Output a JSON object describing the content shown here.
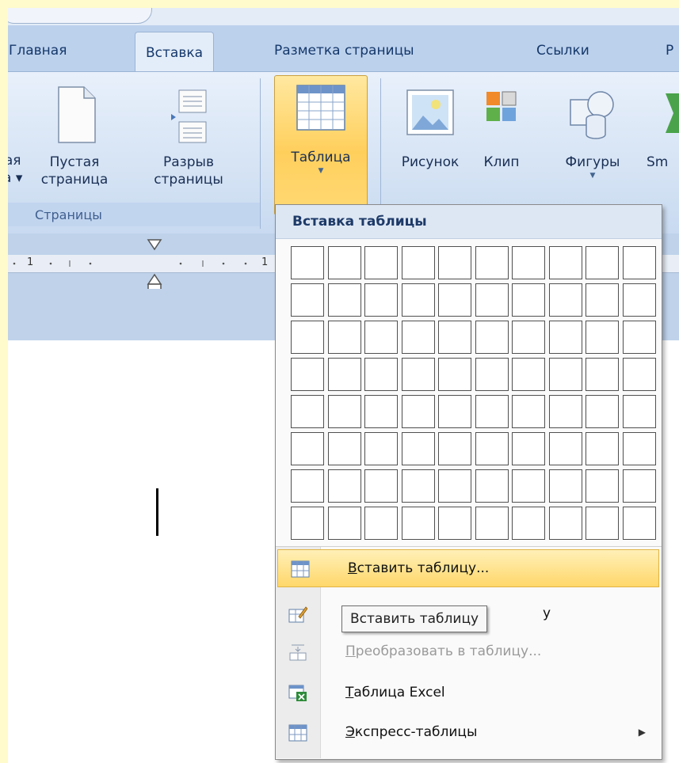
{
  "tabs": [
    {
      "label": "Главная",
      "active": false
    },
    {
      "label": "Вставка",
      "active": true
    },
    {
      "label": "Разметка страницы",
      "active": false
    },
    {
      "label": "Ссылки",
      "active": false
    },
    {
      "label": "Р",
      "active": false
    }
  ],
  "ribbon": {
    "cover_page": {
      "line1": "ая",
      "line2": "а ▾"
    },
    "blank_page": {
      "line1": "Пустая",
      "line2": "страница"
    },
    "page_break": {
      "line1": "Разрыв",
      "line2": "страницы"
    },
    "group_pages": "Страницы",
    "table": {
      "label": "Таблица"
    },
    "picture": {
      "label": "Рисунок"
    },
    "clip": {
      "label": "Клип"
    },
    "shapes": {
      "label": "Фигуры"
    },
    "smartart": {
      "label": "Sm"
    }
  },
  "ruler": {
    "num1": "1",
    "num2": "1"
  },
  "menu": {
    "title": "Вставка таблицы",
    "grid": {
      "columns": 10,
      "rows": 8
    },
    "items": [
      {
        "key": "В",
        "rest": "ставить таблицу...",
        "icon": "table-grid-icon",
        "highlighted": true
      },
      {
        "key": "",
        "rest": "у",
        "icon": "draw-table-icon"
      },
      {
        "key": "П",
        "rest": "реобразовать в таблицу...",
        "icon": "convert-table-icon",
        "disabled": true
      },
      {
        "key": "Т",
        "rest": "аблица Excel",
        "icon": "excel-table-icon"
      },
      {
        "key": "Э",
        "rest": "кспресс-таблицы",
        "icon": "quick-tables-icon"
      }
    ]
  },
  "tooltip": "Вставить таблицу",
  "colors": {
    "accent_orange": "#ffcf5c",
    "ribbon_blue": "#d2e1f3",
    "page_bg": "#fffbcc"
  }
}
